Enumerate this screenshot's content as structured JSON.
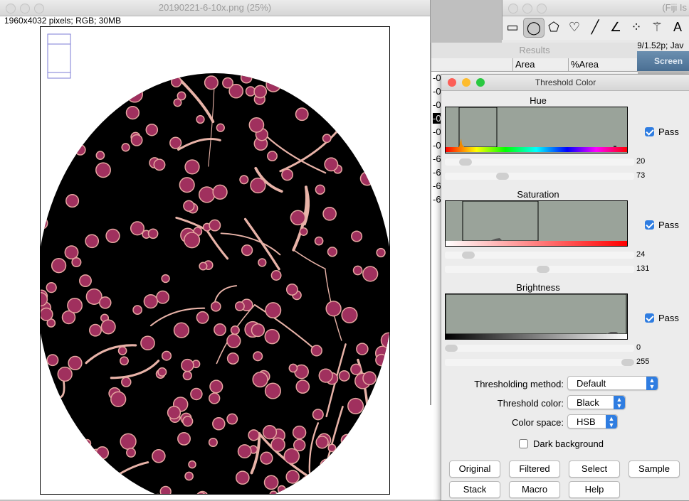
{
  "image_window": {
    "title": "20190221-6-10x.png (25%)",
    "info": "1960x4032 pixels; RGB; 30MB"
  },
  "toolbar": {
    "title": "(Fiji Is",
    "status": "9/1.52p; Jav",
    "tools": [
      {
        "name": "rectangle-tool",
        "glyph": "▭"
      },
      {
        "name": "oval-tool",
        "glyph": "◯"
      },
      {
        "name": "polygon-tool",
        "glyph": "⬠"
      },
      {
        "name": "freehand-tool",
        "glyph": "♡"
      },
      {
        "name": "line-tool",
        "glyph": "╱"
      },
      {
        "name": "angle-tool",
        "glyph": "∠"
      },
      {
        "name": "point-tool",
        "glyph": "⁘"
      },
      {
        "name": "wand-tool",
        "glyph": "⚚"
      },
      {
        "name": "text-tool",
        "glyph": "A"
      },
      {
        "name": "zoom-tool",
        "glyph": "◌"
      }
    ]
  },
  "results": {
    "title": "Results",
    "columns": [
      "Area",
      "%Area"
    ],
    "row_prefix": [
      "-0",
      "-0",
      "-0",
      "-0",
      "-0",
      "-0",
      "-6",
      "-6",
      "-6",
      "-6"
    ],
    "screen_label": "Screen S"
  },
  "threshold": {
    "title": "Threshold Color",
    "hue": {
      "label": "Hue",
      "pass_label": "Pass",
      "pass": true,
      "min": 20,
      "max": 73
    },
    "saturation": {
      "label": "Saturation",
      "pass_label": "Pass",
      "pass": true,
      "min": 24,
      "max": 131
    },
    "brightness": {
      "label": "Brightness",
      "pass_label": "Pass",
      "pass": true,
      "min": 0,
      "max": 255
    },
    "method_label": "Thresholding method:",
    "method_value": "Default",
    "color_label": "Threshold color:",
    "color_value": "Black",
    "space_label": "Color space:",
    "space_value": "HSB",
    "dark_bg_label": "Dark background",
    "dark_bg": false,
    "buttons": {
      "original": "Original",
      "filtered": "Filtered",
      "select": "Select",
      "sample": "Sample",
      "stack": "Stack",
      "macro": "Macro",
      "help": "Help"
    }
  },
  "colors": {
    "accent": "#2f7de1",
    "histogram_bg": "#9aa39a",
    "tissue_pink": "#e6a6a0",
    "cell_magenta": "#a0305e"
  }
}
